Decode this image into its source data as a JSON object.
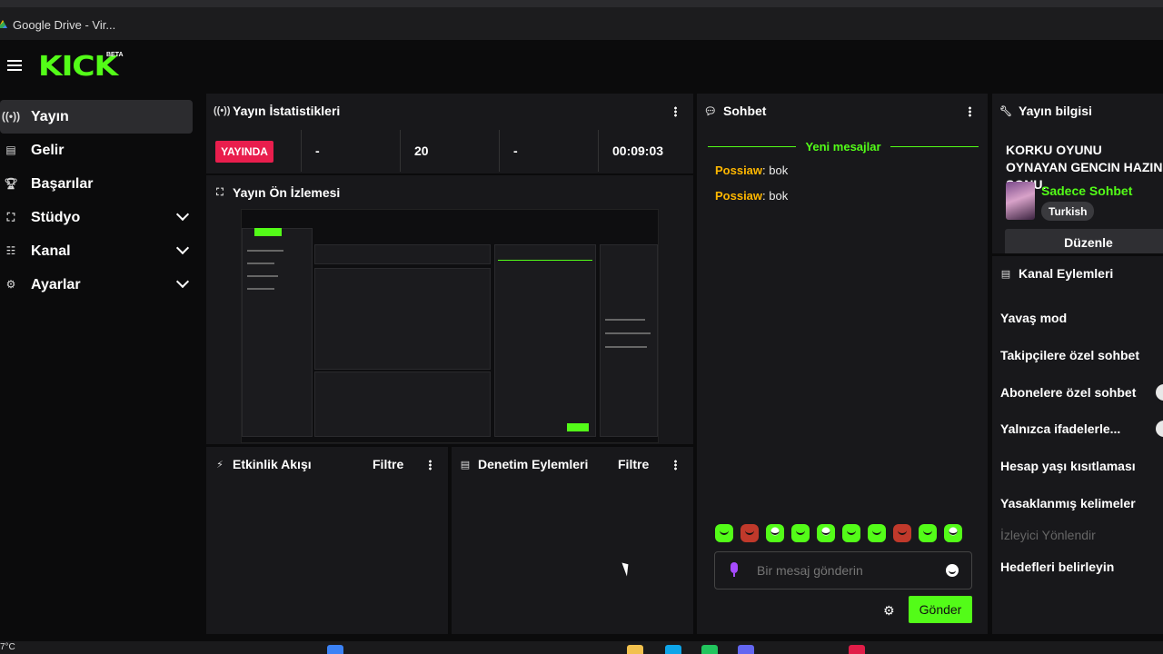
{
  "browser": {
    "tab_title": "Google Drive - Vir..."
  },
  "header": {
    "logo_text": "KICK",
    "logo_badge": "BETA"
  },
  "sidebar": {
    "items": [
      {
        "label": "Yayın",
        "icon": "broadcast-icon",
        "active": true
      },
      {
        "label": "Gelir",
        "icon": "chart-icon"
      },
      {
        "label": "Başarılar",
        "icon": "trophy-icon"
      },
      {
        "label": "Stüdyo",
        "icon": "studio-icon",
        "expandable": true
      },
      {
        "label": "Kanal",
        "icon": "users-icon",
        "expandable": true
      },
      {
        "label": "Ayarlar",
        "icon": "gear-icon",
        "expandable": true
      }
    ]
  },
  "stats_panel": {
    "title": "Yayın İstatistikleri",
    "live_label": "YAYINDA",
    "values": [
      "-",
      "20",
      "-",
      "00:09:03"
    ]
  },
  "preview_panel": {
    "title": "Yayın Ön İzlemesi"
  },
  "activity_panel": {
    "title": "Etkinlik Akışı",
    "filter_label": "Filtre"
  },
  "moderation_panel": {
    "title": "Denetim Eylemleri",
    "filter_label": "Filtre"
  },
  "chat": {
    "title": "Sohbet",
    "new_messages_label": "Yeni mesajlar",
    "messages": [
      {
        "user": "Possiaw",
        "sep": ":",
        "text": " bok"
      },
      {
        "user": "Possiaw",
        "sep": ":",
        "text": " bok"
      }
    ],
    "input_placeholder": "Bir mesaj gönderin",
    "send_label": "Gönder"
  },
  "stream_info": {
    "title": "Yayın bilgisi",
    "stream_title": "KORKU OYUNU OYNAYAN GENCIN HAZIN SONU.",
    "category": "Sadece Sohbet",
    "language": "Turkish",
    "edit_label": "Düzenle"
  },
  "channel_actions": {
    "title": "Kanal Eylemleri",
    "items": [
      {
        "label": "Yavaş mod"
      },
      {
        "label": "Takipçilere özel sohbet"
      },
      {
        "label": "Abonelere özel sohbet",
        "toggle": true
      },
      {
        "label": "Yalnızca ifadelerle...",
        "toggle": true
      },
      {
        "label": "Hesap yaşı kısıtlaması"
      },
      {
        "label": "Yasaklanmış kelimeler"
      },
      {
        "label": "İzleyici Yönlendir",
        "disabled": true
      },
      {
        "label": "Hedefleri belirleyin"
      }
    ]
  },
  "taskbar": {
    "temperature": "7°C"
  },
  "colors": {
    "accent": "#53fc18",
    "live": "#e91e4d",
    "username": "#ffb700",
    "panel": "#18181b"
  }
}
